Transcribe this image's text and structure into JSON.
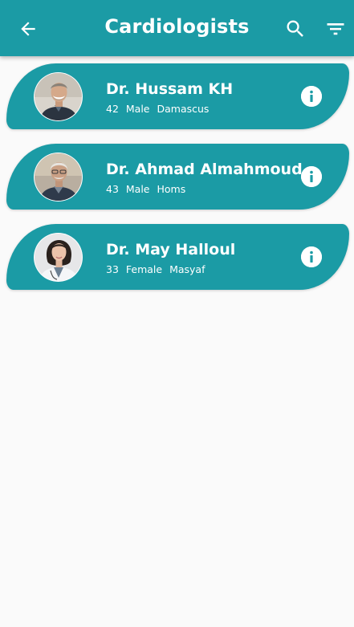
{
  "appbar": {
    "title": "Cardiologists",
    "back_icon": "arrow-back-icon",
    "search_icon": "search-icon",
    "filter_icon": "filter-icon"
  },
  "colors": {
    "primary": "#1b9ba5",
    "background": "#fafafa",
    "text_on_primary": "#ffffff"
  },
  "doctors": [
    {
      "name": "Dr. Hussam KH",
      "age": "42",
      "gender": "Male",
      "city": "Damascus"
    },
    {
      "name": "Dr. Ahmad Almahmoud",
      "age": "43",
      "gender": "Male",
      "city": "Homs"
    },
    {
      "name": "Dr. May Halloul",
      "age": "33",
      "gender": "Female",
      "city": "Masyaf"
    }
  ]
}
